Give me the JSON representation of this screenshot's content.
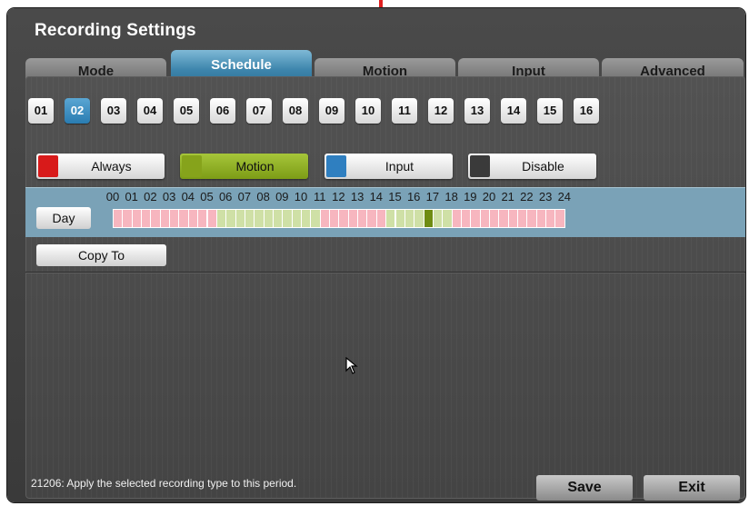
{
  "window": {
    "title": "Recording Settings"
  },
  "tabs": [
    {
      "label": "Mode",
      "active": false
    },
    {
      "label": "Schedule",
      "active": true
    },
    {
      "label": "Motion",
      "active": false
    },
    {
      "label": "Input",
      "active": false
    },
    {
      "label": "Advanced",
      "active": false
    }
  ],
  "channels": [
    "01",
    "02",
    "03",
    "04",
    "05",
    "06",
    "07",
    "08",
    "09",
    "10",
    "11",
    "12",
    "13",
    "14",
    "15",
    "16"
  ],
  "selected_channel": "02",
  "record_types": [
    {
      "label": "Always",
      "color": "#d81a1a",
      "active": false
    },
    {
      "label": "Motion",
      "color": "#86a31b",
      "active": true
    },
    {
      "label": "Input",
      "color": "#2f7fc0",
      "active": false
    },
    {
      "label": "Disable",
      "color": "#3a3a3a",
      "active": false
    }
  ],
  "schedule": {
    "day_label": "Day",
    "hours": [
      "00",
      "01",
      "02",
      "03",
      "04",
      "05",
      "06",
      "07",
      "08",
      "09",
      "10",
      "11",
      "12",
      "13",
      "14",
      "15",
      "16",
      "17",
      "18",
      "19",
      "20",
      "21",
      "22",
      "23",
      "24"
    ],
    "half_hour_types": "AAAAAAAAAAAMMMMMMMMMMMAAAAAAAMMMMSMMAAAAAAAAAAAAAAAAAAAAAAAAAAAAAAA",
    "colors": {
      "always": "#f7b6bf",
      "motion": "#cfe0a6",
      "selected": "#6f8c12"
    }
  },
  "copy_to": {
    "label": "Copy To"
  },
  "status": {
    "message": "21206: Apply the selected recording type to this period."
  },
  "footer": {
    "save_label": "Save",
    "exit_label": "Exit"
  }
}
